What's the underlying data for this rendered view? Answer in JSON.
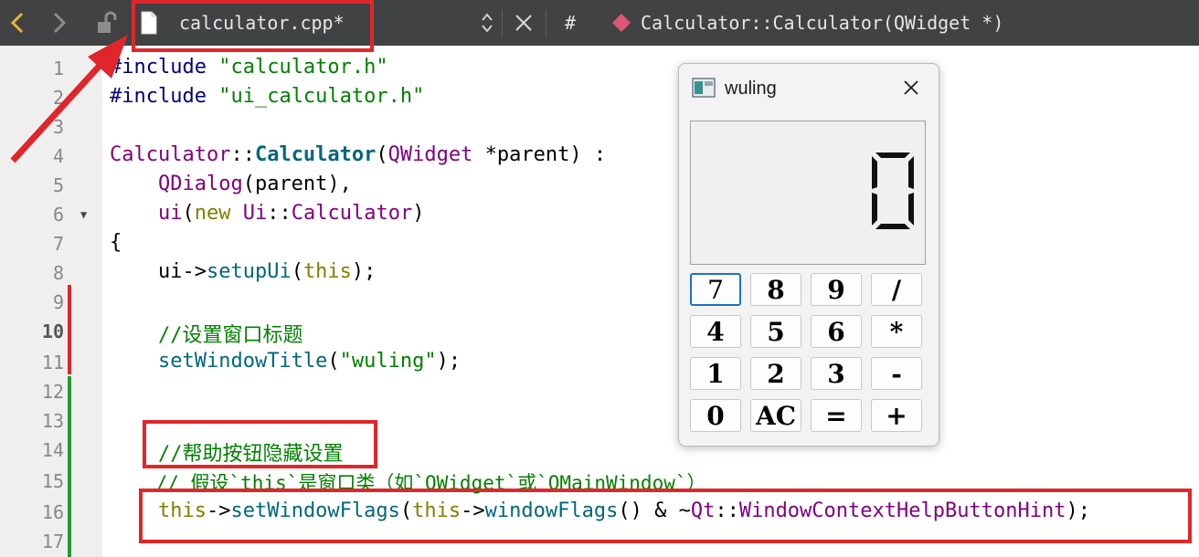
{
  "toolbar": {
    "back_icon": "chevron-left-icon",
    "forward_icon": "chevron-right-icon",
    "lock_icon": "unlocked-icon",
    "file_icon": "document-icon",
    "file_name": "calculator.cpp*",
    "hash": "#",
    "symbol_icon": "method-diamond-icon",
    "symbol": "Calculator::Calculator(QWidget *)",
    "colors": {
      "back_arrow": "#e8b43a",
      "symbol_diamond": "#e0567a",
      "background": "#404244"
    }
  },
  "gutter": {
    "line_numbers": [
      "1",
      "2",
      "3",
      "4",
      "5",
      "6",
      "7",
      "8",
      "9",
      "10",
      "11",
      "12",
      "13",
      "14",
      "15",
      "16",
      "17"
    ],
    "current_line": "10"
  },
  "code": {
    "l1_a": "#include ",
    "l1_b": "\"calculator.h\"",
    "l2_a": "#include ",
    "l2_b": "\"ui_calculator.h\"",
    "l4_a": "Calculator",
    "l4_b": "::",
    "l4_c": "Calculator",
    "l4_d": "(",
    "l4_e": "QWidget",
    "l4_f": " *parent) :",
    "l5_a": "    ",
    "l5_b": "QDialog",
    "l5_c": "(parent),",
    "l6_a": "    ",
    "l6_b": "ui",
    "l6_c": "(",
    "l6_d": "new",
    "l6_e": " ",
    "l6_f": "Ui",
    "l6_g": "::",
    "l6_h": "Calculator",
    "l6_i": ")",
    "l7": "{",
    "l8_a": "    ui->",
    "l8_b": "setupUi",
    "l8_c": "(",
    "l8_d": "this",
    "l8_e": ");",
    "l10": "    //设置窗口标题",
    "l11_a": "    ",
    "l11_b": "setWindowTitle",
    "l11_c": "(",
    "l11_d": "\"wuling\"",
    "l11_e": ");",
    "l14": "    //帮助按钮隐藏设置",
    "l15": "    // 假设`this`是窗口类（如`QWidget`或`QMainWindow`）",
    "l16_a": "    ",
    "l16_b": "this",
    "l16_c": "->",
    "l16_d": "setWindowFlags",
    "l16_e": "(",
    "l16_f": "this",
    "l16_g": "->",
    "l16_h": "windowFlags",
    "l16_i": "() & ~",
    "l16_j": "Qt",
    "l16_k": "::",
    "l16_l": "WindowContextHelpButtonHint",
    "l16_m": ");"
  },
  "calculator": {
    "title": "wuling",
    "app_icon": "calculator-app-icon",
    "close_icon": "close-icon",
    "display_value": "0",
    "keys": [
      [
        "7",
        "8",
        "9",
        "/"
      ],
      [
        "4",
        "5",
        "6",
        "*"
      ],
      [
        "1",
        "2",
        "3",
        "-"
      ],
      [
        "0",
        "AC",
        "=",
        "+"
      ]
    ],
    "focused_key": "7"
  }
}
